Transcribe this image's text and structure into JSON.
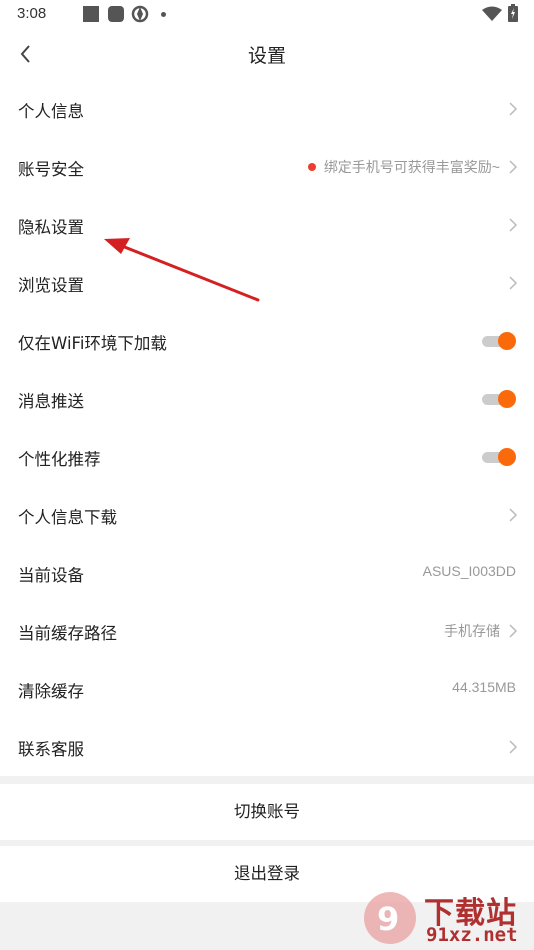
{
  "status_bar": {
    "time": "3:08"
  },
  "header": {
    "title": "设置"
  },
  "rows": [
    {
      "label": "个人信息",
      "type": "arrow"
    },
    {
      "label": "账号安全",
      "type": "arrow",
      "hint": "绑定手机号可获得丰富奖励~"
    },
    {
      "label": "隐私设置",
      "type": "arrow"
    },
    {
      "label": "浏览设置",
      "type": "arrow"
    },
    {
      "label": "仅在WiFi环境下加载",
      "type": "toggle",
      "on": true
    },
    {
      "label": "消息推送",
      "type": "toggle",
      "on": true
    },
    {
      "label": "个性化推荐",
      "type": "toggle",
      "on": true
    },
    {
      "label": "个人信息下载",
      "type": "arrow"
    },
    {
      "label": "当前设备",
      "type": "value",
      "value": "ASUS_I003DD"
    },
    {
      "label": "当前缓存路径",
      "type": "arrow",
      "value": "手机存储"
    },
    {
      "label": "清除缓存",
      "type": "value",
      "value": "44.315MB"
    },
    {
      "label": "联系客服",
      "type": "arrow"
    }
  ],
  "switch_account": "切换账号",
  "logout": "退出登录",
  "watermark": {
    "brand": "下载站",
    "site": "91xz.net"
  },
  "colors": {
    "accent": "#fa6a0a",
    "red_dot": "#f03c2e",
    "annotation_arrow": "#d42020"
  }
}
